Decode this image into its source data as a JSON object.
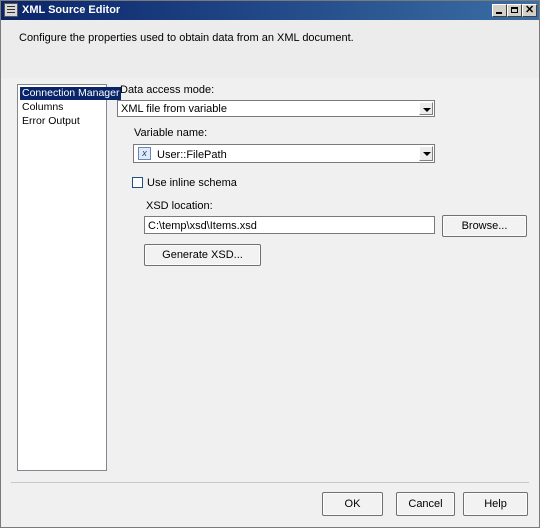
{
  "window": {
    "title": "XML Source Editor"
  },
  "header": {
    "description": "Configure the properties used to obtain data from an XML document."
  },
  "sidebar": {
    "items": [
      {
        "label": "Connection Manager",
        "selected": true
      },
      {
        "label": "Columns",
        "selected": false
      },
      {
        "label": "Error Output",
        "selected": false
      }
    ]
  },
  "form": {
    "data_access_mode_label": "Data access mode:",
    "data_access_mode_value": "XML file from variable",
    "variable_name_label": "Variable name:",
    "variable_name_value": "User::FilePath",
    "inline_schema_label": "Use inline schema",
    "inline_schema_checked": false,
    "xsd_location_label": "XSD location:",
    "xsd_location_value": "C:\\temp\\xsd\\Items.xsd",
    "browse_label": "Browse...",
    "generate_xsd_label": "Generate XSD..."
  },
  "footer": {
    "ok_label": "OK",
    "cancel_label": "Cancel",
    "help_label": "Help"
  },
  "icons": {
    "window": "dialog-icon",
    "variable": "variable-icon"
  }
}
